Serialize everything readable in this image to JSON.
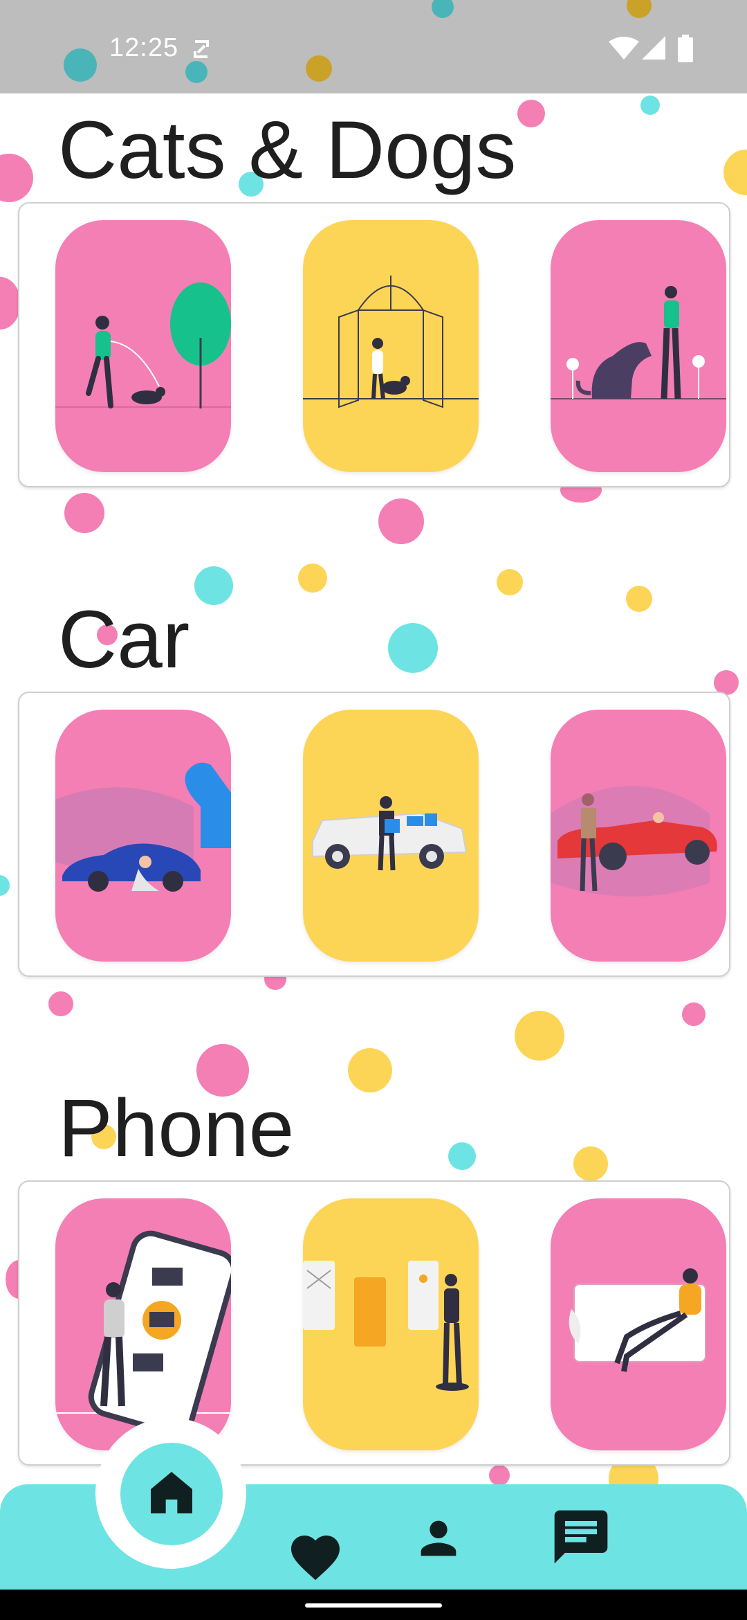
{
  "status_bar": {
    "time": "12:25",
    "icons": [
      "sync-off-icon",
      "wifi-icon",
      "cellular-signal-icon",
      "battery-icon"
    ]
  },
  "sections": [
    {
      "title": "Cats & Dogs",
      "cards": [
        {
          "color": "#f47fb4",
          "illustration": "person-walking-dog-icon"
        },
        {
          "color": "#fdd556",
          "illustration": "person-with-dog-at-door-icon"
        },
        {
          "color": "#f47fb4",
          "illustration": "person-petting-large-dog-icon"
        }
      ]
    },
    {
      "title": "Car",
      "cards": [
        {
          "color": "#f47fb4",
          "illustration": "person-fixing-blue-car-icon"
        },
        {
          "color": "#fdd556",
          "illustration": "person-loading-white-car-icon"
        },
        {
          "color": "#f47fb4",
          "illustration": "red-convertible-car-icon"
        }
      ]
    },
    {
      "title": "Phone",
      "cards": [
        {
          "color": "#f47fb4",
          "illustration": "person-with-giant-phone-icon"
        },
        {
          "color": "#fdd556",
          "illustration": "person-with-app-screens-icon"
        },
        {
          "color": "#f47fb4",
          "illustration": "person-sitting-on-tablet-icon"
        }
      ]
    }
  ],
  "bottom_nav": {
    "items": [
      {
        "icon": "home-icon",
        "selected": true
      },
      {
        "icon": "heart-icon",
        "selected": false
      },
      {
        "icon": "person-icon",
        "selected": false
      },
      {
        "icon": "chat-icon",
        "selected": false
      }
    ]
  },
  "colors": {
    "pink": "#f47fb4",
    "yellow": "#fdd556",
    "cyan": "#6ee3e3",
    "teal": "#4ab5b8",
    "status_bar": "#bdbdbd"
  }
}
